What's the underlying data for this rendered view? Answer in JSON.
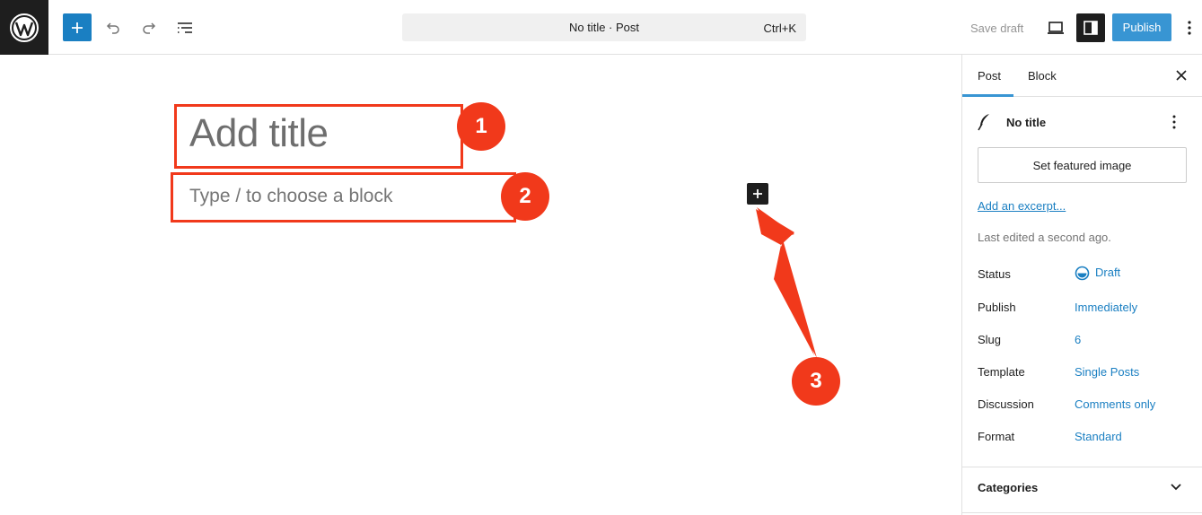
{
  "topbar": {
    "command_title": "No title · Post",
    "command_shortcut": "Ctrl+K",
    "save_draft": "Save draft",
    "publish": "Publish"
  },
  "editor": {
    "title_placeholder": "Add title",
    "block_placeholder": "Type / to choose a block"
  },
  "annotations": [
    {
      "label": "1"
    },
    {
      "label": "2"
    },
    {
      "label": "3"
    }
  ],
  "sidebar": {
    "tabs": [
      {
        "label": "Post",
        "active": true
      },
      {
        "label": "Block",
        "active": false
      }
    ],
    "post_title": "No title",
    "featured_image_button": "Set featured image",
    "excerpt_link": "Add an excerpt...",
    "last_edited": "Last edited a second ago.",
    "rows": [
      {
        "label": "Status",
        "value": "Draft"
      },
      {
        "label": "Publish",
        "value": "Immediately"
      },
      {
        "label": "Slug",
        "value": "6"
      },
      {
        "label": "Template",
        "value": "Single Posts"
      },
      {
        "label": "Discussion",
        "value": "Comments only"
      },
      {
        "label": "Format",
        "value": "Standard"
      }
    ],
    "categories": "Categories"
  },
  "colors": {
    "accent": "#3895d3",
    "inserter": "#1a7fc2",
    "annotation": "#f1391b",
    "dark": "#1e1e1e"
  },
  "icons": [
    "wordpress-logo-icon",
    "plus-icon",
    "undo-icon",
    "redo-icon",
    "document-overview-icon",
    "desktop-preview-icon",
    "sidebar-settings-icon",
    "more-vertical-icon",
    "close-icon",
    "post-feather-icon",
    "status-draft-icon",
    "chevron-down-icon"
  ]
}
